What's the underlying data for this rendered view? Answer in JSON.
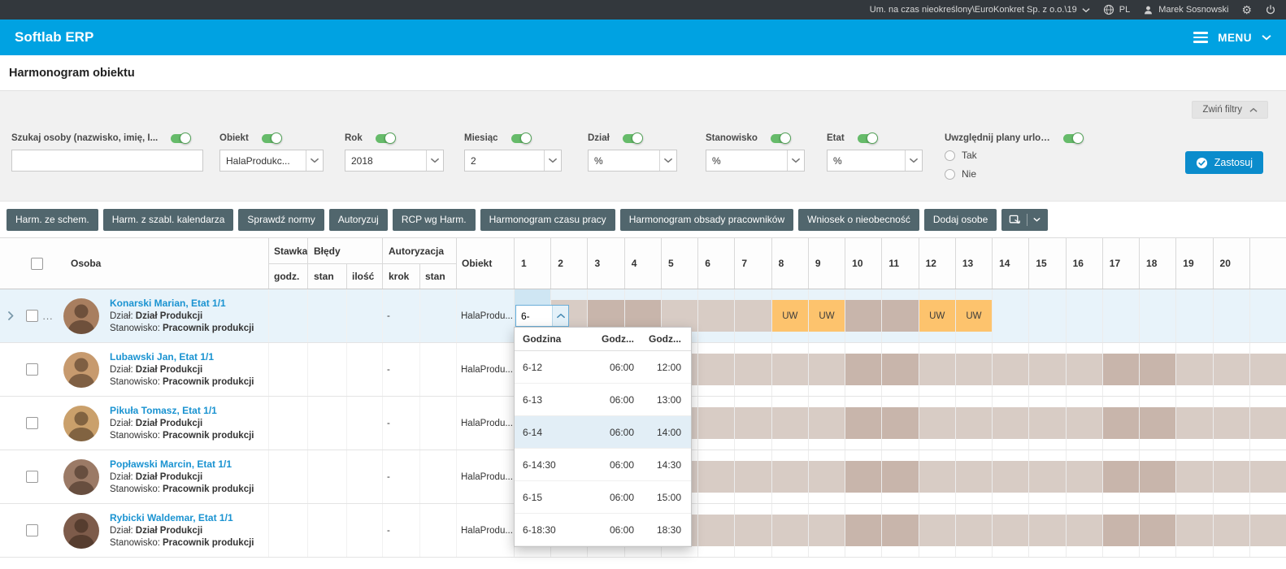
{
  "topbar": {
    "context": "Um. na czas nieokreślony\\EuroKonkret Sp. z o.o.\\19",
    "lang": "PL",
    "user": "Marek Sosnowski"
  },
  "appbar": {
    "brand": "Softlab ERP",
    "menu_label": "MENU"
  },
  "page": {
    "title": "Harmonogram obiektu"
  },
  "filters": {
    "collapse_label": "Zwiń filtry",
    "apply_label": "Zastosuj",
    "fields": [
      {
        "key": "szukaj-osoby",
        "label": "Szukaj osoby (nazwisko, imię, I...",
        "type": "text",
        "value": ""
      },
      {
        "key": "obiekt",
        "label": "Obiekt",
        "type": "select",
        "value": "HalaProdukc..."
      },
      {
        "key": "rok",
        "label": "Rok",
        "type": "select",
        "value": "2018"
      },
      {
        "key": "miesiac",
        "label": "Miesiąc",
        "type": "select",
        "value": "2"
      },
      {
        "key": "dzial",
        "label": "Dział",
        "type": "select",
        "value": "%"
      },
      {
        "key": "stanowisko",
        "label": "Stanowisko",
        "type": "select",
        "value": "%"
      },
      {
        "key": "etat",
        "label": "Etat",
        "type": "select",
        "value": "%"
      },
      {
        "key": "plany-urlopowe",
        "label": "Uwzględnij plany urlop...",
        "type": "radio",
        "options": [
          "Tak",
          "Nie"
        ]
      }
    ]
  },
  "toolbar": {
    "buttons": [
      "Harm. ze schem.",
      "Harm. z szabl. kalendarza",
      "Sprawdź normy",
      "Autoryzuj",
      "RCP wg Harm.",
      "Harmonogram czasu pracy",
      "Harmonogram obsady pracowników",
      "Wniosek o nieobecność",
      "Dodaj osobe"
    ]
  },
  "labels": {
    "uw": "UW",
    "ellipsis": "..."
  },
  "table": {
    "headers": {
      "osoba": "Osoba",
      "stawka": "Stawka",
      "stawka_sub": "godz.",
      "bledy": "Błędy",
      "bledy_sub_stan": "stan",
      "bledy_sub_ilosc": "ilość",
      "autoryzacja": "Autoryzacja",
      "autoryzacja_sub_krok": "krok",
      "autoryzacja_sub_stan": "stan",
      "obiekt": "Obiekt",
      "days": [
        "1",
        "2",
        "3",
        "4",
        "5",
        "6",
        "7",
        "8",
        "9",
        "10",
        "11",
        "12",
        "13",
        "14",
        "15",
        "16",
        "17",
        "18",
        "19",
        "20"
      ]
    },
    "rows": [
      {
        "name": "Konarski Marian, Etat 1/1",
        "dzial_label": "Dział:",
        "dzial": "Dział Produkcji",
        "stanowisko_label": "Stanowisko:",
        "stanowisko": "Pracownik produkcji",
        "krok": "-",
        "obiekt": "HalaProdu...",
        "selected": true,
        "editor_value": "6-",
        "avatar_color": "#a87e5f",
        "schedule": [
          "editor",
          "work",
          "weekend",
          "weekend",
          "work",
          "work",
          "work",
          "uw",
          "uw",
          "weekend",
          "weekend",
          "uw",
          "uw",
          "empty",
          "empty",
          "empty",
          "empty",
          "empty",
          "empty",
          "empty",
          "empty"
        ]
      },
      {
        "name": "Lubawski Jan, Etat 1/1",
        "dzial_label": "Dział:",
        "dzial": "Dział Produkcji",
        "stanowisko_label": "Stanowisko:",
        "stanowisko": "Pracownik produkcji",
        "krok": "-",
        "obiekt": "HalaProdu...",
        "selected": false,
        "avatar_color": "#c79a6e",
        "schedule": [
          "work",
          "work",
          "weekend",
          "weekend",
          "work",
          "work",
          "work",
          "work",
          "work",
          "weekend",
          "weekend",
          "work",
          "work",
          "work",
          "work",
          "work",
          "weekend",
          "weekend",
          "work",
          "work",
          "work"
        ]
      },
      {
        "name": "Pikuła Tomasz, Etat 1/1",
        "dzial_label": "Dział:",
        "dzial": "Dział Produkcji",
        "stanowisko_label": "Stanowisko:",
        "stanowisko": "Pracownik produkcji",
        "krok": "-",
        "obiekt": "HalaProdu...",
        "selected": false,
        "avatar_color": "#caa06b",
        "schedule": [
          "work",
          "work",
          "weekend",
          "weekend",
          "work",
          "work",
          "work",
          "work",
          "work",
          "weekend",
          "weekend",
          "work",
          "work",
          "work",
          "work",
          "work",
          "weekend",
          "weekend",
          "work",
          "work",
          "work"
        ]
      },
      {
        "name": "Popławski Marcin, Etat 1/1",
        "dzial_label": "Dział:",
        "dzial": "Dział Produkcji",
        "stanowisko_label": "Stanowisko:",
        "stanowisko": "Pracownik produkcji",
        "krok": "-",
        "obiekt": "HalaProdu...",
        "selected": false,
        "avatar_color": "#9b7a66",
        "schedule": [
          "work",
          "work",
          "weekend",
          "weekend",
          "work",
          "work",
          "work",
          "work",
          "work",
          "weekend",
          "weekend",
          "work",
          "work",
          "work",
          "work",
          "work",
          "weekend",
          "weekend",
          "work",
          "work",
          "work"
        ]
      },
      {
        "name": "Rybicki Waldemar, Etat 1/1",
        "dzial_label": "Dział:",
        "dzial": "Dział Produkcji",
        "stanowisko_label": "Stanowisko:",
        "stanowisko": "Pracownik produkcji",
        "krok": "-",
        "obiekt": "HalaProdu...",
        "selected": false,
        "avatar_color": "#7d5b4a",
        "schedule": [
          "work",
          "work",
          "weekend",
          "weekend",
          "work",
          "work",
          "work",
          "work",
          "work",
          "weekend",
          "weekend",
          "work",
          "work",
          "work",
          "work",
          "work",
          "weekend",
          "weekend",
          "work",
          "work",
          "work"
        ]
      }
    ]
  },
  "dropdown": {
    "headers": [
      "Godzina",
      "Godz...",
      "Godz..."
    ],
    "options": [
      {
        "label": "6-12",
        "from": "06:00",
        "to": "12:00",
        "highlighted": false
      },
      {
        "label": "6-13",
        "from": "06:00",
        "to": "13:00",
        "highlighted": false
      },
      {
        "label": "6-14",
        "from": "06:00",
        "to": "14:00",
        "highlighted": true
      },
      {
        "label": "6-14:30",
        "from": "06:00",
        "to": "14:30",
        "highlighted": false
      },
      {
        "label": "6-15",
        "from": "06:00",
        "to": "15:00",
        "highlighted": false
      },
      {
        "label": "6-18:30",
        "from": "06:00",
        "to": "18:30",
        "highlighted": false
      }
    ]
  },
  "colors": {
    "brand_blue": "#00a2e2",
    "apply_blue": "#0b8ccc",
    "toolbar_button": "#51666d",
    "toggle_green": "#66bb6a",
    "work_fill": "#d8ccc5",
    "weekend_fill": "#c8b5ab",
    "uw_fill": "#fdc36d",
    "selected_row": "#e8f3fa",
    "name_link": "#1a93d1"
  }
}
